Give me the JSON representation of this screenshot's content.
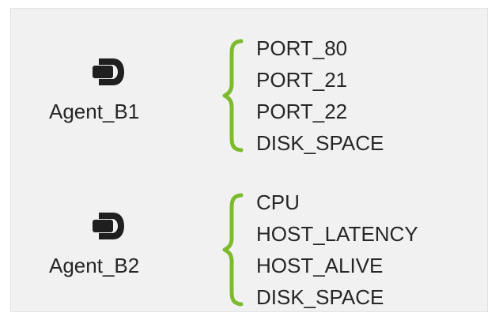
{
  "agents": [
    {
      "name": "Agent_B1",
      "icon": "agent-icon",
      "metrics": [
        "PORT_80",
        "PORT_21",
        "PORT_22",
        "DISK_SPACE"
      ]
    },
    {
      "name": "Agent_B2",
      "icon": "agent-icon",
      "metrics": [
        "CPU",
        "HOST_LATENCY",
        "HOST_ALIVE",
        "DISK_SPACE"
      ]
    }
  ],
  "colors": {
    "brace": "#7dbb2e",
    "icon": "#1f1f1f",
    "text": "#262626",
    "background": "#f1f1f1"
  }
}
